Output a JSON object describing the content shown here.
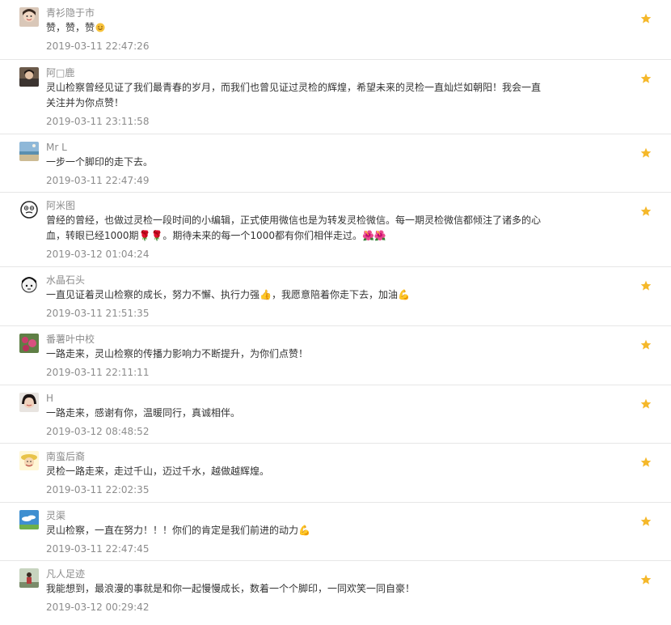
{
  "colors": {
    "star": "#f5b82a",
    "divider": "#e6e6e6",
    "meta_text": "#8c8c8c",
    "body_text": "#333333"
  },
  "comments": [
    {
      "avatar_icon": "user-avatar-icon",
      "nickname": "青衫隐于市",
      "content": "赞，赞，赞",
      "emoji_icon": "smile-emoji-icon",
      "time": "2019-03-11 22:47:26"
    },
    {
      "avatar_icon": "user-avatar-icon",
      "nickname": "阿□鹿",
      "content": "灵山检察曾经见证了我们最青春的岁月，而我们也曾见证过灵检的辉煌，希望未来的灵检一直灿烂如朝阳！我会一直\n关注并为你点赞！",
      "time": "2019-03-11 23:11:58"
    },
    {
      "avatar_icon": "user-avatar-icon",
      "nickname": "Mr L",
      "content": "一步一个脚印的走下去。",
      "time": "2019-03-11 22:47:49"
    },
    {
      "avatar_icon": "user-avatar-icon",
      "nickname": "阿米图",
      "content": "曾经的曾经，也做过灵检一段时间的小编辑，正式使用微信也是为转发灵检微信。每一期灵检微信都倾注了诸多的心\n血，转眼已经1000期🌹🌹。期待未来的每一个1000都有你们相伴走过。🌺🌺",
      "time": "2019-03-12 01:04:24"
    },
    {
      "avatar_icon": "user-avatar-icon",
      "nickname": "水晶石头",
      "content": "一直见证着灵山检察的成长，努力不懈、执行力强👍，我愿意陪着你走下去，加油💪",
      "time": "2019-03-11 21:51:35"
    },
    {
      "avatar_icon": "user-avatar-icon",
      "nickname": "番薯叶中校",
      "content": "一路走来，灵山检察的传播力影响力不断提升，为你们点赞！",
      "time": "2019-03-11 22:11:11"
    },
    {
      "avatar_icon": "user-avatar-icon",
      "nickname": "H",
      "content": "一路走来，感谢有你，温暖同行，真诚相伴。",
      "time": "2019-03-12 08:48:52"
    },
    {
      "avatar_icon": "user-avatar-icon",
      "nickname": "南蛮后裔",
      "content": "灵检一路走来，走过千山，迈过千水，越做越辉煌。",
      "time": "2019-03-11 22:02:35"
    },
    {
      "avatar_icon": "user-avatar-icon",
      "nickname": "灵渠",
      "content": "灵山检察，一直在努力！！！你们的肯定是我们前进的动力💪",
      "time": "2019-03-11 22:47:45"
    },
    {
      "avatar_icon": "user-avatar-icon",
      "nickname": "凡人足迹",
      "content": "我能想到，最浪漫的事就是和你一起慢慢成长，数着一个个脚印，一同欢笑一同自豪！",
      "time": "2019-03-12 00:29:42"
    }
  ]
}
